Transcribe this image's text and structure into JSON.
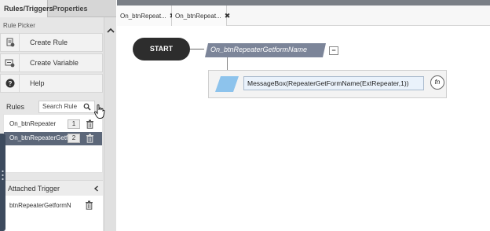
{
  "left_panel": {
    "tabs": [
      "Rules/Triggers",
      "Properties"
    ],
    "rule_picker": {
      "title": "Rule Picker",
      "items": [
        {
          "label": "Create Rule",
          "icon": "create-rule-icon"
        },
        {
          "label": "Create Variable",
          "icon": "create-variable-icon"
        },
        {
          "label": "Help",
          "icon": "help-icon"
        }
      ]
    },
    "rules": {
      "title": "Rules",
      "search_label": "Search Rule",
      "items": [
        {
          "name": "On_btnRepeater",
          "count": "1",
          "selected": false
        },
        {
          "name": "On_btnRepeaterGetfo",
          "count": "2",
          "selected": true
        }
      ]
    },
    "attached_trigger": {
      "title": "Attached Trigger",
      "items": [
        {
          "name": "btnRepeaterGetformN"
        }
      ]
    }
  },
  "editor": {
    "tabs": [
      {
        "label": "On_btnRepeat...",
        "close": "✖"
      },
      {
        "label": "On_btnRepeat...",
        "close": "✖"
      }
    ],
    "start_label": "START",
    "rule_name": "On_btnRepeaterGetformName",
    "collapse_label": "−",
    "action_text": "MessageBox(RepeaterGetFormName(ExtRepeater,1))",
    "fn_label": "fn"
  },
  "colors": {
    "selected_row": "#5c6779",
    "rule_name_bg": "#7c8599",
    "action_para": "#8dc3ec",
    "start_bg": "#2d2d2d"
  }
}
